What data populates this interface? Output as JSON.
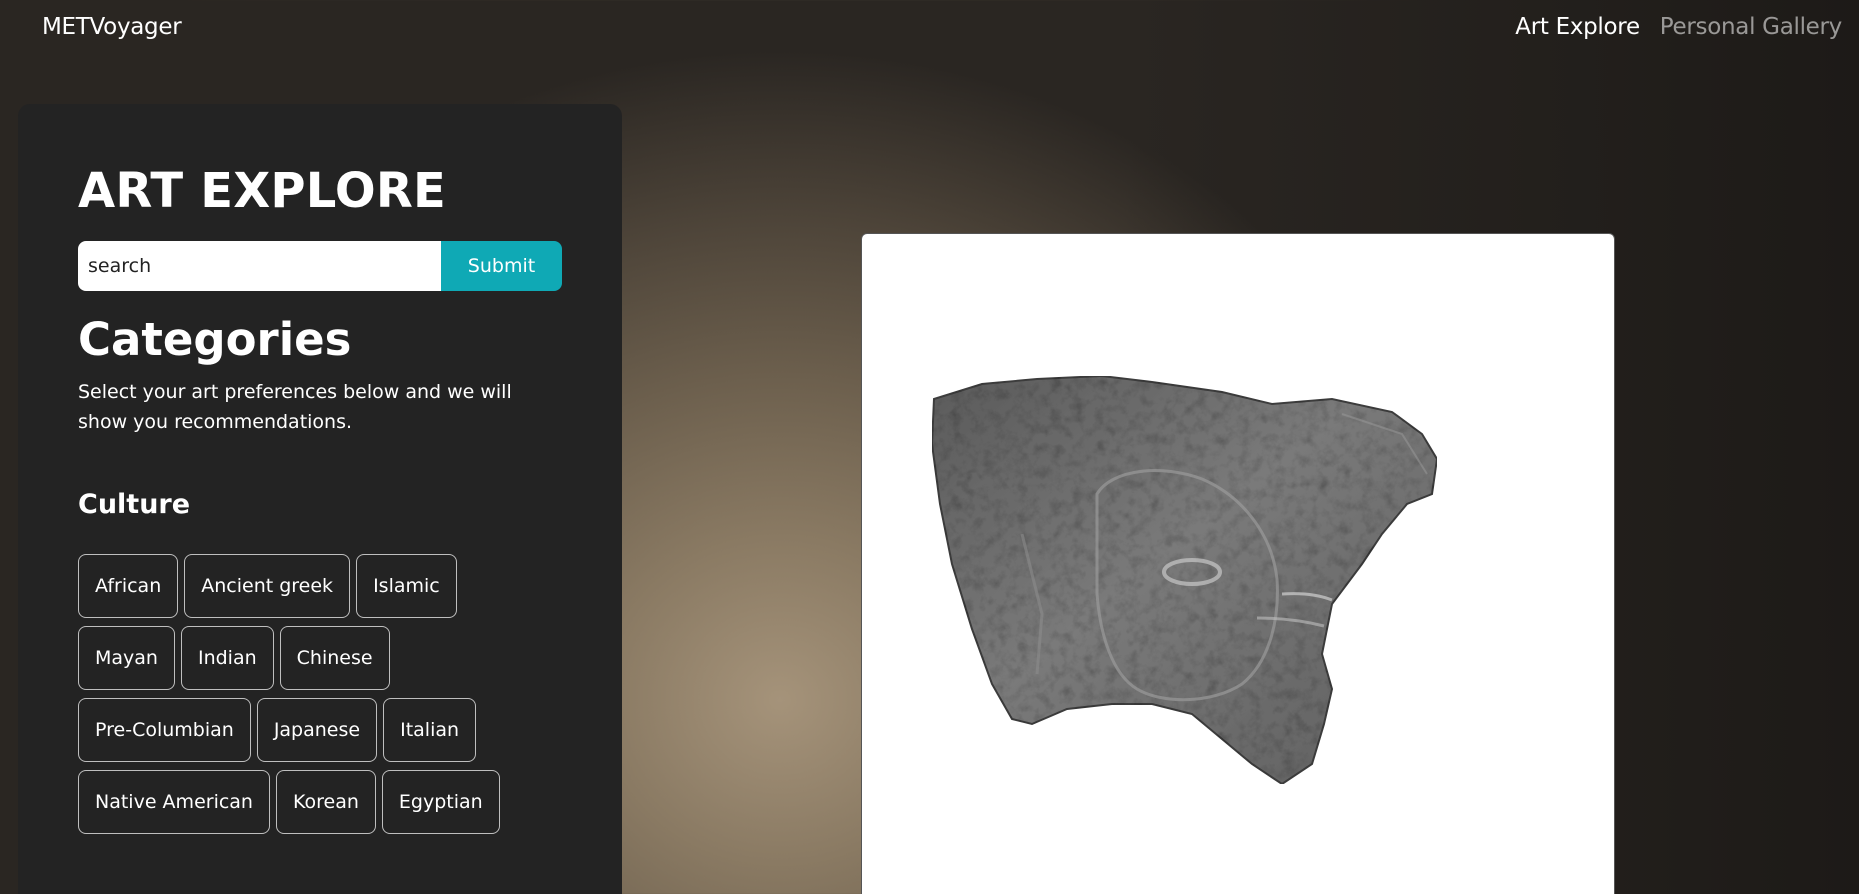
{
  "navbar": {
    "brand": "METVoyager",
    "links": [
      {
        "label": "Art Explore",
        "active": true
      },
      {
        "label": "Personal Gallery",
        "active": false
      }
    ]
  },
  "sidebar": {
    "title": "ART EXPLORE",
    "search": {
      "placeholder": "search",
      "value": "",
      "submit_label": "Submit"
    },
    "categories_heading": "Categories",
    "categories_desc": "Select your art preferences below and we will show you recommendations.",
    "culture_heading": "Culture",
    "culture_chips": [
      "African",
      "Ancient greek",
      "Islamic",
      "Mayan",
      "Indian",
      "Chinese",
      "Pre-Columbian",
      "Japanese",
      "Italian",
      "Native American",
      "Korean",
      "Egyptian"
    ]
  },
  "artwork": {
    "image_icon": "stone-relief-fragment-image"
  },
  "colors": {
    "accent": "#0fa9b5",
    "panel": "#232323"
  }
}
